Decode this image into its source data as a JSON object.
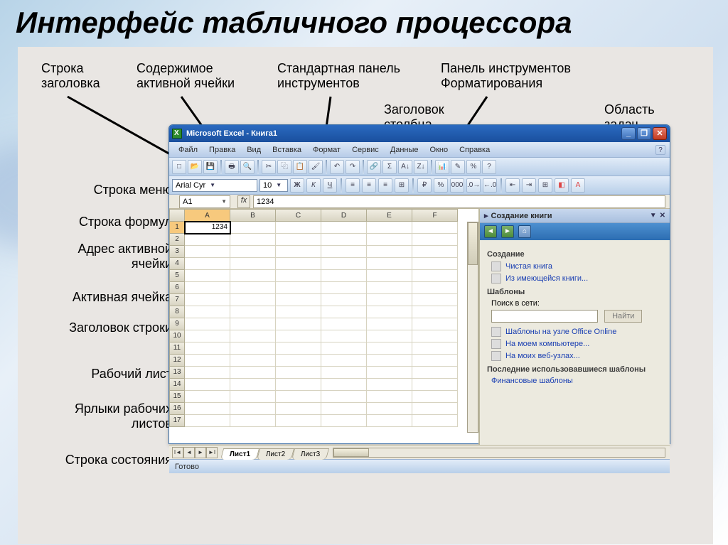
{
  "page_title": "Интерфейс табличного процессора",
  "captions_top": {
    "title_bar": "Строка\nзаголовка",
    "active_cell_content": "Содержимое\nактивной ячейки",
    "standard_toolbar": "Стандартная панель\nинструментов",
    "formatting_toolbar": "Панель инструментов\nФорматирования",
    "column_header": "Заголовок\nстолбца",
    "task_pane": "Область\nзадач"
  },
  "captions_left": {
    "menu_bar": "Строка меню",
    "formula_bar": "Строка формул",
    "namebox": "Адрес активной\nячейки",
    "active_cell": "Активная ячейка",
    "row_header": "Заголовок строки",
    "worksheet": "Рабочий лист",
    "sheet_tabs": "Ярлыки рабочих\nлистов",
    "status_bar": "Строка состояния"
  },
  "titlebar": {
    "app": "Microsoft Excel - Книга1"
  },
  "window_buttons": {
    "min": "_",
    "max": "❐",
    "close": "✕"
  },
  "menu": [
    "Файл",
    "Правка",
    "Вид",
    "Вставка",
    "Формат",
    "Сервис",
    "Данные",
    "Окно",
    "Справка"
  ],
  "format_bar": {
    "font": "Arial Cyr",
    "size": "10"
  },
  "formula_bar": {
    "name": "A1",
    "fx": "fx",
    "value": "1234"
  },
  "columns": [
    "A",
    "B",
    "C",
    "D",
    "E",
    "F"
  ],
  "rows": [
    "1",
    "2",
    "3",
    "4",
    "5",
    "6",
    "7",
    "8",
    "9",
    "10",
    "11",
    "12",
    "13",
    "14",
    "15",
    "16",
    "17"
  ],
  "active_cell_value": "1234",
  "taskpane": {
    "title": "Создание книги",
    "section_create": "Создание",
    "link_blank": "Чистая книга",
    "link_existing": "Из имеющейся книги...",
    "section_templates": "Шаблоны",
    "search_label": "Поиск в сети:",
    "search_button": "Найти",
    "link_office_online": "Шаблоны на узле Office Online",
    "link_my_computer": "На моем компьютере...",
    "link_my_websites": "На моих веб-узлах...",
    "section_recent": "Последние использовавшиеся шаблоны",
    "link_financial": "Финансовые шаблоны"
  },
  "sheet_tabs": [
    "Лист1",
    "Лист2",
    "Лист3"
  ],
  "status": "Готово"
}
